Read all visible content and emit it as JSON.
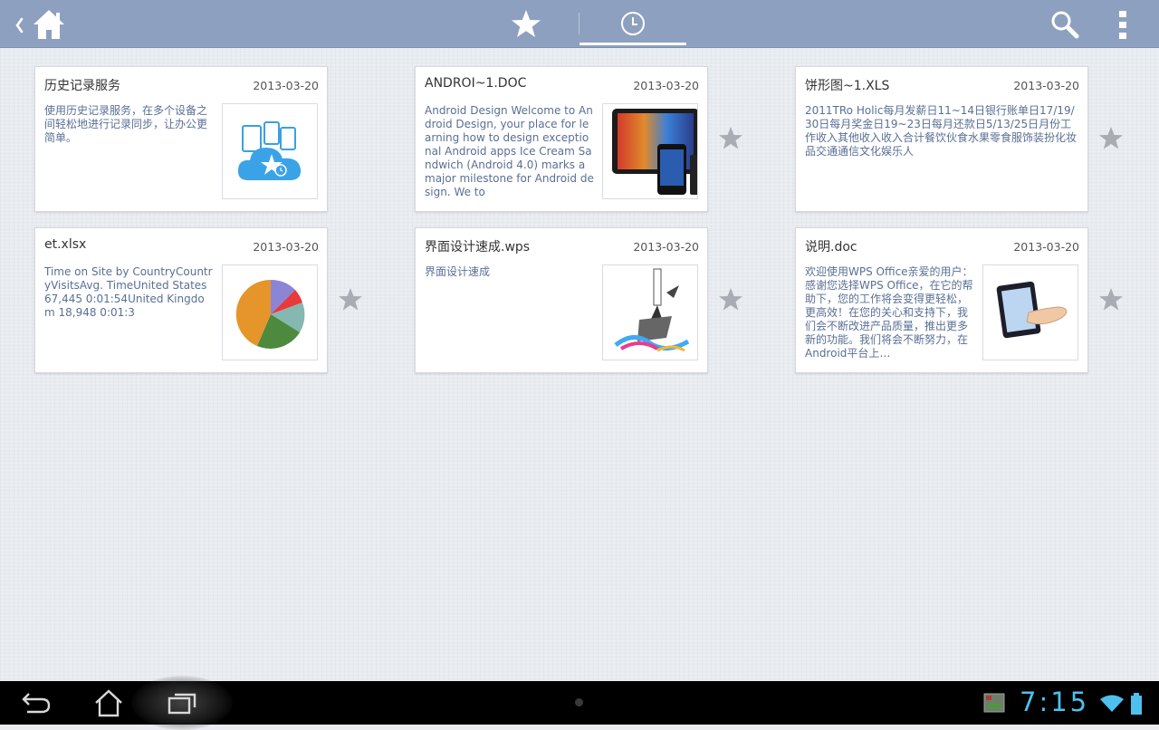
{
  "tabs": {
    "favorites_icon": "star-icon",
    "recent_icon": "clock-icon",
    "active": "recent"
  },
  "cards": [
    {
      "title": "历史记录服务",
      "date": "2013-03-20",
      "desc": "使用历史记录服务，在多个设备之间轻松地进行记录同步，让办公更简单。",
      "thumb": "cloud-history-thumbnail"
    },
    {
      "title": "ANDROI~1.DOC",
      "date": "2013-03-20",
      "desc": "Android Design    Welcome to Android Design, your place for learning how to design exceptional Android apps     Ice Cream Sandwich (Android 4.0) marks a major milestone for Android design. We to",
      "thumb": "android-devices-thumbnail"
    },
    {
      "title": "饼形图~1.XLS",
      "date": "2013-03-20",
      "desc": "2011TRo Holic每月发薪日11~14日银行账单日17/19/30日每月奖金日19~23日每月还款日5/13/25日月份工作收入其他收入收入合计餐饮伙食水果零食服饰装扮化妆品交通通信文化娱乐人",
      "thumb": ""
    },
    {
      "title": "et.xlsx",
      "date": "2013-03-20",
      "desc": "Time on Site by CountryCountryVisitsAvg. TimeUnited States 67,445 0:01:54United Kingdom 18,948 0:01:3",
      "thumb": "pie-chart-thumbnail"
    },
    {
      "title": "界面设计速成.wps",
      "date": "2013-03-20",
      "desc": "界面设计速成",
      "thumb": "artwork-thumbnail"
    },
    {
      "title": "说明.doc",
      "date": "2013-03-20",
      "desc": "欢迎使用WPS Office亲爱的用户：感谢您选择WPS Office，在它的帮助下，您的工作将会变得更轻松，更高效！在您的关心和支持下，我们会不断改进产品质量，推出更多新的功能。我们将会不断努力，在Android平台上…",
      "thumb": "tablet-hand-thumbnail"
    }
  ],
  "status_bar": {
    "time": "7:15"
  },
  "colors": {
    "topbar": "#8ea0bf",
    "accent_clock": "#4ec0ee",
    "desc_text": "#5a6f94",
    "star_gray": "#a9adb3"
  }
}
